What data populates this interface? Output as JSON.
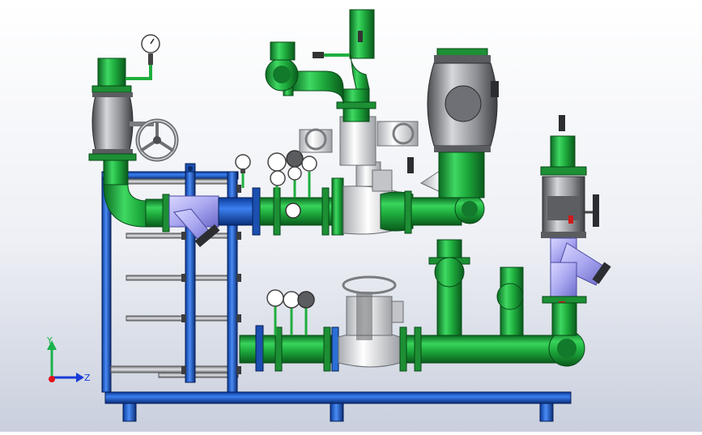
{
  "viewport": {
    "background_top": "#ffffff",
    "background_bottom": "#c9cfdd"
  },
  "triad": {
    "y_label": "Y",
    "z_label": "Z",
    "x_color": "#e0121b",
    "y_color": "#19b24b",
    "z_color": "#1a3bd6"
  },
  "colors": {
    "pipe_green": "#1fae3e",
    "frame_blue": "#2a6fd6",
    "strainer_lavender": "#a9a7f0",
    "valve_gray": "#8e9095",
    "valve_white": "#eef0f2",
    "base_navy": "#123a9c"
  },
  "icons": {
    "triad": "coordinate-triad-icon",
    "gauge": "pressure-gauge-icon",
    "handwheel": "handwheel-icon"
  }
}
